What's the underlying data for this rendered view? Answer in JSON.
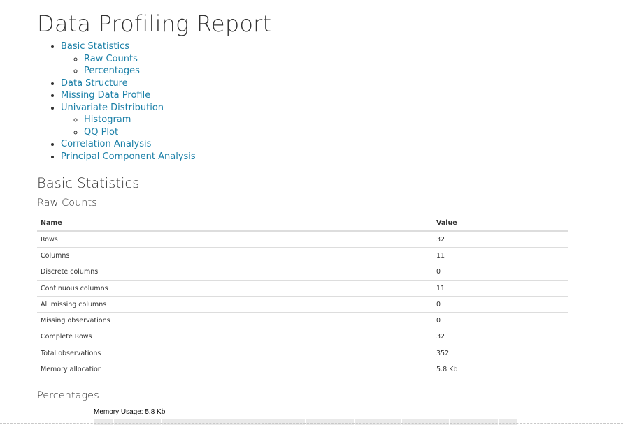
{
  "report": {
    "title": "Data Profiling Report"
  },
  "toc": {
    "basic_statistics": "Basic Statistics",
    "raw_counts": "Raw Counts",
    "percentages": "Percentages",
    "data_structure": "Data Structure",
    "missing_data_profile": "Missing Data Profile",
    "univariate_distribution": "Univariate Distribution",
    "histogram": "Histogram",
    "qq_plot": "QQ Plot",
    "correlation_analysis": "Correlation Analysis",
    "principal_component_analysis": "Principal Component Analysis"
  },
  "basic_statistics": {
    "heading": "Basic Statistics",
    "raw_counts": {
      "heading": "Raw Counts",
      "columns": [
        "Name",
        "Value"
      ],
      "rows": [
        {
          "name": "Rows",
          "value": "32"
        },
        {
          "name": "Columns",
          "value": "11"
        },
        {
          "name": "Discrete columns",
          "value": "0"
        },
        {
          "name": "Continuous columns",
          "value": "11"
        },
        {
          "name": "All missing columns",
          "value": "0"
        },
        {
          "name": "Missing observations",
          "value": "0"
        },
        {
          "name": "Complete Rows",
          "value": "32"
        },
        {
          "name": "Total observations",
          "value": "352"
        },
        {
          "name": "Memory allocation",
          "value": "5.8 Kb"
        }
      ]
    },
    "percentages": {
      "heading": "Percentages",
      "memory_usage_label": "Memory Usage: 5.8 Kb"
    }
  },
  "colors": {
    "link": "#1a7fa7",
    "text": "#333333",
    "rule": "#dddddd"
  }
}
